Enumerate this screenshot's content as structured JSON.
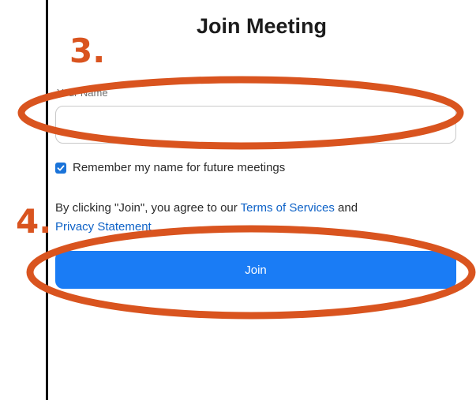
{
  "dialog": {
    "title": "Join Meeting",
    "name_label": "Your Name",
    "name_value": "",
    "name_placeholder": "",
    "remember_checked": true,
    "remember_label": "Remember my name for future meetings",
    "legal_prefix": "By clicking \"Join\", you agree to our ",
    "terms_link": "Terms of Services",
    "legal_and": " and ",
    "privacy_link": "Privacy Statement",
    "join_label": "Join"
  },
  "annotations": {
    "step_3": "3.",
    "step_4": "4.",
    "color": "#d9541f"
  },
  "colors": {
    "primary": "#1a7cf5",
    "link": "#0e62c7",
    "checkbox": "#1a73d9"
  }
}
